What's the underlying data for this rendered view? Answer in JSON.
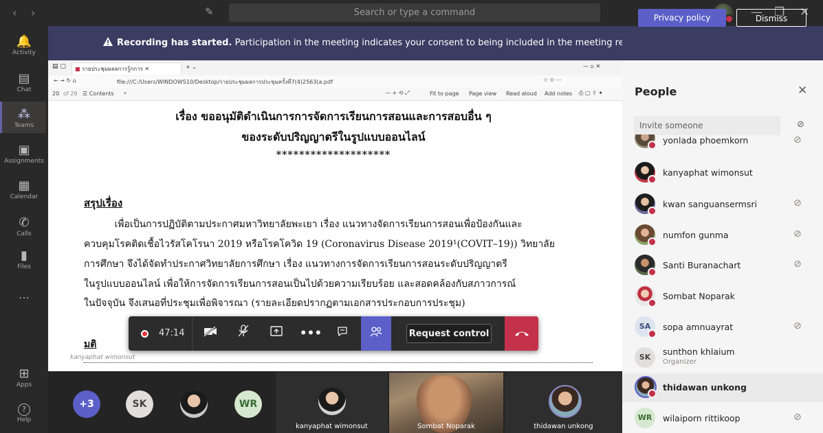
{
  "titlebar": {
    "search_placeholder": "Search or type a command",
    "back": "‹",
    "forward": "›",
    "compose_icon": "✎",
    "minimize": "—",
    "maximize": "❐",
    "close": "✕"
  },
  "rail": [
    {
      "label": "Activity",
      "icon": "bell-icon",
      "glyph": "🔔"
    },
    {
      "label": "Chat",
      "icon": "chat-icon",
      "glyph": "▤"
    },
    {
      "label": "Teams",
      "icon": "teams-icon",
      "glyph": "⁂"
    },
    {
      "label": "Assignments",
      "icon": "assignments-icon",
      "glyph": "▣"
    },
    {
      "label": "Calendar",
      "icon": "calendar-icon",
      "glyph": "▦"
    },
    {
      "label": "Calls",
      "icon": "phone-icon",
      "glyph": "✆"
    },
    {
      "label": "Files",
      "icon": "files-icon",
      "glyph": "▮"
    },
    {
      "label": "Apps",
      "icon": "apps-icon",
      "glyph": "⊞"
    },
    {
      "label": "Help",
      "icon": "help-icon",
      "glyph": "?"
    }
  ],
  "more": "…",
  "banner": {
    "bold": "Recording has started.",
    "text": " Participation in the meeting indicates your consent to being included in the meeting recording.",
    "privacy": "Privacy policy",
    "dismiss": "Dismiss"
  },
  "shared": {
    "tab_title": "รายประชุมผลลการรู้กการ",
    "address": "file:///C:/Users/WINDOWS10/Desktop/รายประชุมผลการประชุมครั้งที่7(4)2563(a.pdf",
    "page_num": "20",
    "page_total": "of 29",
    "contents": "Contents",
    "tools": [
      "Fit to page",
      "Page view",
      "Read aloud",
      "Add notes"
    ],
    "doc": {
      "heading1": "เรื่อง ขออนุมัติดำเนินการการจัดการเรียนการสอนและการสอบอื่น ๆ",
      "heading2": "ของระดับปริญญาตรีในรูปแบบออนไลน์",
      "stars": "********************",
      "section": "สรุปเรื่อง",
      "lines": [
        "          เพื่อเป็นการปฏิบัติตามประกาศมหาวิทยาลัยพะเยา เรื่อง แนวทางจัดการเรียนการสอนเพื่อป้องกันและ",
        "ควบคุมโรคติดเชื้อไวรัสโคโรนา 2019 หรือโรคโควิด 19 (Coronavirus Disease 2019¹(COVIT–19)) วิทยาลัย",
        "การศึกษา จึงได้จัดทำประกาศวิทยาลัยการศึกษา เรื่อง แนวทางการจัดการเรียนการสอนระดับปริญญาตรี",
        "ในรูปแบบออนไลน์ เพื่อให้การจัดการเรียนการสอนเป็นไปด้วยความเรียบร้อย และสอดคล้องกับสภาวการณ์",
        "ในปัจจุบัน จึงเสนอที่ประชุมเพื่อพิจารณา (รายละเอียดปรากฏตามเอกสารประกอบการประชุม)"
      ],
      "resolution": "มติ",
      "sharer": "kanyaphat wimonsut"
    }
  },
  "controls": {
    "timer": "47:14",
    "request_control": "Request control"
  },
  "strip": {
    "overflow": "+3",
    "bubbles": [
      "SK",
      "",
      "WR"
    ],
    "tiles": [
      "kanyaphat wimonsut",
      "Sombat Noparak",
      "thidawan unkong"
    ]
  },
  "people": {
    "title": "People",
    "invite": "Invite someone",
    "list": [
      {
        "name": "yonlada phoemkorn",
        "initials": "",
        "muted": true,
        "sub": ""
      },
      {
        "name": "kanyaphat wimonsut",
        "initials": "",
        "muted": false,
        "sub": ""
      },
      {
        "name": "kwan sanguansermsri",
        "initials": "",
        "muted": true,
        "sub": ""
      },
      {
        "name": "numfon gunma",
        "initials": "",
        "muted": true,
        "sub": ""
      },
      {
        "name": "Santi Buranachart",
        "initials": "",
        "muted": true,
        "sub": ""
      },
      {
        "name": "Sombat Noparak",
        "initials": "",
        "muted": false,
        "sub": ""
      },
      {
        "name": "sopa amnuayrat",
        "initials": "SA",
        "muted": true,
        "sub": ""
      },
      {
        "name": "sunthon khlaium",
        "initials": "SK",
        "muted": false,
        "sub": "Organizer"
      },
      {
        "name": "thidawan unkong",
        "initials": "",
        "muted": false,
        "sub": ""
      },
      {
        "name": "wilaiporn rittikoop",
        "initials": "WR",
        "muted": true,
        "sub": ""
      }
    ]
  }
}
